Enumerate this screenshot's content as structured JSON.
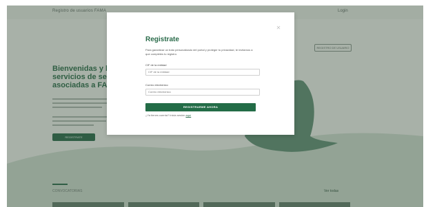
{
  "header": {
    "brand": "Registro de usuarios FAMA",
    "login": "Login",
    "cta": "REGISTRO DE USUARIO"
  },
  "hero": {
    "title_lines": [
      "Bienvenidas y b",
      "servicios de se",
      "asociadas a FAI"
    ],
    "button": "REGISTRATE"
  },
  "section": {
    "title": "CONVOCATORIAS",
    "link": "Ver todas"
  },
  "modal": {
    "close_icon": "close-icon",
    "title": "Registrate",
    "description": "Para garantizar un trato personalizado del portal y proteger tu privacidad, te invitamos a que completes tu registro.",
    "email_label": "CIF de la entidad",
    "email_placeholder": "CIF de la entidad",
    "second_label": "Correo electrónico",
    "second_placeholder": "Correo electrónico",
    "submit": "REGISTRARME AHORA",
    "login_prompt": "¿Ya tienes cuenta? Inicia sesión",
    "login_link": "aquí"
  },
  "colors": {
    "brand_green": "#236c47",
    "title_green": "#2a6b4a",
    "page_background": "#d6ded6"
  }
}
